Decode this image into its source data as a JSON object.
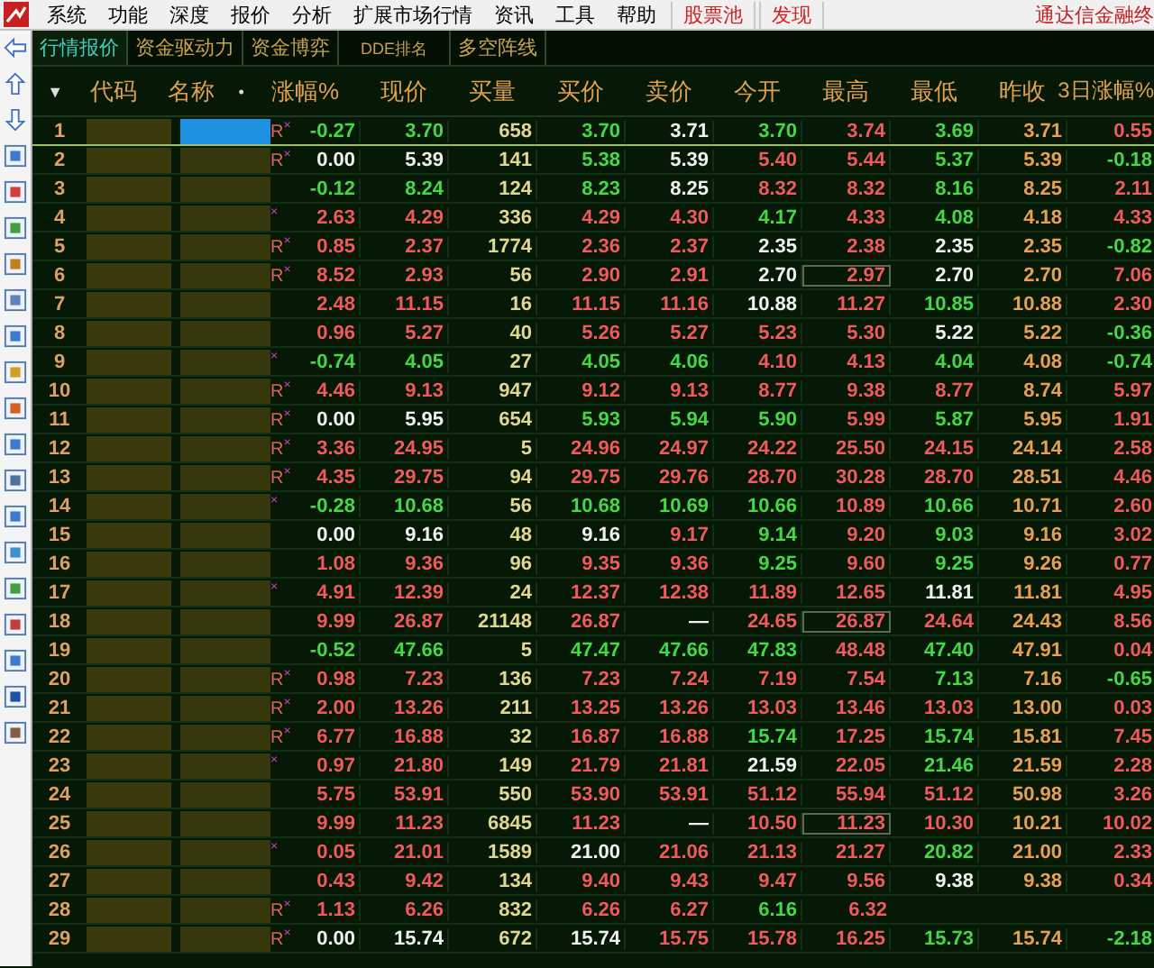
{
  "menu": {
    "items": [
      "系统",
      "功能",
      "深度",
      "报价",
      "分析",
      "扩展市场行情",
      "资讯",
      "工具",
      "帮助"
    ],
    "highlights": [
      "股票池",
      "发现"
    ],
    "brand": "通达信金融终"
  },
  "tabs": [
    {
      "label": "行情报价",
      "selected": true
    },
    {
      "label": "资金驱动力",
      "selected": false
    },
    {
      "label": "资金博弈",
      "selected": false
    },
    {
      "label": "DDE排名",
      "selected": false
    },
    {
      "label": "多空阵线",
      "selected": false
    }
  ],
  "header": {
    "menu_glyph": "▼",
    "code": "代码",
    "name": "名称",
    "mark": "•",
    "columns": [
      "涨幅%",
      "现价",
      "买量",
      "买价",
      "卖价",
      "今开",
      "最高",
      "最低",
      "昨收",
      "3日涨幅%"
    ]
  },
  "rows": [
    {
      "no": "1",
      "selected": true,
      "flag": "R$^{×}$",
      "cells": [
        {
          "text": "-0.27",
          "color": "#44d844"
        },
        {
          "text": "3.70",
          "color": "#44d844"
        },
        {
          "text": "658"
        },
        {
          "text": "3.70",
          "color": "#44d844"
        },
        {
          "text": "3.71",
          "color": "#f0f0f0"
        },
        {
          "text": "3.70",
          "color": "#44d844"
        },
        {
          "text": "3.74",
          "color": "#f05a5a"
        },
        {
          "text": "3.69",
          "color": "#44d844"
        },
        {
          "text": "3.71"
        },
        {
          "text": "0.55",
          "color": "#f05a5a"
        }
      ]
    },
    {
      "no": "2",
      "selected": false,
      "flag": "R$^{×}$",
      "cells": [
        {
          "text": "0.00",
          "color": "#f0f0f0"
        },
        {
          "text": "5.39",
          "color": "#f0f0f0"
        },
        {
          "text": "141"
        },
        {
          "text": "5.38",
          "color": "#44d844"
        },
        {
          "text": "5.39",
          "color": "#f0f0f0"
        },
        {
          "text": "5.40",
          "color": "#f05a5a"
        },
        {
          "text": "5.44",
          "color": "#f05a5a"
        },
        {
          "text": "5.37",
          "color": "#44d844"
        },
        {
          "text": "5.39"
        },
        {
          "text": "-0.18",
          "color": "#44d844"
        }
      ]
    },
    {
      "no": "3",
      "selected": false,
      "cells": [
        {
          "text": "-0.12",
          "color": "#44d844"
        },
        {
          "text": "8.24",
          "color": "#44d844"
        },
        {
          "text": "124"
        },
        {
          "text": "8.23",
          "color": "#44d844"
        },
        {
          "text": "8.25",
          "color": "#f0f0f0"
        },
        {
          "text": "8.32",
          "color": "#f05a5a"
        },
        {
          "text": "8.32",
          "color": "#f05a5a"
        },
        {
          "text": "8.16",
          "color": "#44d844"
        },
        {
          "text": "8.25"
        },
        {
          "text": "2.11",
          "color": "#f05a5a"
        }
      ]
    },
    {
      "no": "4",
      "selected": false,
      "flag": "$^{×}$",
      "cells": [
        {
          "text": "2.63",
          "color": "#f05a5a"
        },
        {
          "text": "4.29",
          "color": "#f05a5a"
        },
        {
          "text": "336"
        },
        {
          "text": "4.29",
          "color": "#f05a5a"
        },
        {
          "text": "4.30",
          "color": "#f05a5a"
        },
        {
          "text": "4.17",
          "color": "#44d844"
        },
        {
          "text": "4.33",
          "color": "#f05a5a"
        },
        {
          "text": "4.08",
          "color": "#44d844"
        },
        {
          "text": "4.18"
        },
        {
          "text": "4.33",
          "color": "#f05a5a"
        }
      ]
    },
    {
      "no": "5",
      "selected": false,
      "flag": "R$^{×}$",
      "cells": [
        {
          "text": "0.85",
          "color": "#f05a5a"
        },
        {
          "text": "2.37",
          "color": "#f05a5a"
        },
        {
          "text": "1774"
        },
        {
          "text": "2.36",
          "color": "#f05a5a"
        },
        {
          "text": "2.37",
          "color": "#f05a5a"
        },
        {
          "text": "2.35",
          "color": "#f0f0f0"
        },
        {
          "text": "2.38",
          "color": "#f05a5a"
        },
        {
          "text": "2.35",
          "color": "#f0f0f0"
        },
        {
          "text": "2.35"
        },
        {
          "text": "-0.82",
          "color": "#44d844"
        }
      ]
    },
    {
      "no": "6",
      "selected": false,
      "flag": "R$^{×}$",
      "cells": [
        {
          "text": "8.52",
          "color": "#f05a5a"
        },
        {
          "text": "2.93",
          "color": "#f05a5a"
        },
        {
          "text": "56"
        },
        {
          "text": "2.90",
          "color": "#f05a5a"
        },
        {
          "text": "2.91",
          "color": "#f05a5a"
        },
        {
          "text": "2.70",
          "color": "#f0f0f0"
        },
        {
          "text": "2.97",
          "color": "#f05a5a",
          "framed": true
        },
        {
          "text": "2.70",
          "color": "#f0f0f0"
        },
        {
          "text": "2.70"
        },
        {
          "text": "7.06",
          "color": "#f05a5a"
        }
      ]
    },
    {
      "no": "7",
      "selected": false,
      "cells": [
        {
          "text": "2.48",
          "color": "#f05a5a"
        },
        {
          "text": "11.15",
          "color": "#f05a5a"
        },
        {
          "text": "16"
        },
        {
          "text": "11.15",
          "color": "#f05a5a"
        },
        {
          "text": "11.16",
          "color": "#f05a5a"
        },
        {
          "text": "10.88",
          "color": "#f0f0f0"
        },
        {
          "text": "11.27",
          "color": "#f05a5a"
        },
        {
          "text": "10.85",
          "color": "#44d844"
        },
        {
          "text": "10.88"
        },
        {
          "text": "2.30",
          "color": "#f05a5a"
        }
      ]
    },
    {
      "no": "8",
      "selected": false,
      "cells": [
        {
          "text": "0.96",
          "color": "#f05a5a"
        },
        {
          "text": "5.27",
          "color": "#f05a5a"
        },
        {
          "text": "40"
        },
        {
          "text": "5.26",
          "color": "#f05a5a"
        },
        {
          "text": "5.27",
          "color": "#f05a5a"
        },
        {
          "text": "5.23",
          "color": "#f05a5a"
        },
        {
          "text": "5.30",
          "color": "#f05a5a"
        },
        {
          "text": "5.22",
          "color": "#f0f0f0"
        },
        {
          "text": "5.22"
        },
        {
          "text": "-0.36",
          "color": "#44d844"
        }
      ]
    },
    {
      "no": "9",
      "selected": false,
      "flag": "$^{×}$",
      "cells": [
        {
          "text": "-0.74",
          "color": "#44d844"
        },
        {
          "text": "4.05",
          "color": "#44d844"
        },
        {
          "text": "27"
        },
        {
          "text": "4.05",
          "color": "#44d844"
        },
        {
          "text": "4.06",
          "color": "#44d844"
        },
        {
          "text": "4.10",
          "color": "#f05a5a"
        },
        {
          "text": "4.13",
          "color": "#f05a5a"
        },
        {
          "text": "4.04",
          "color": "#44d844"
        },
        {
          "text": "4.08"
        },
        {
          "text": "-0.74",
          "color": "#44d844"
        }
      ]
    },
    {
      "no": "10",
      "selected": false,
      "flag": "R$^{×}$",
      "cells": [
        {
          "text": "4.46",
          "color": "#f05a5a"
        },
        {
          "text": "9.13",
          "color": "#f05a5a"
        },
        {
          "text": "947"
        },
        {
          "text": "9.12",
          "color": "#f05a5a"
        },
        {
          "text": "9.13",
          "color": "#f05a5a"
        },
        {
          "text": "8.77",
          "color": "#f05a5a"
        },
        {
          "text": "9.38",
          "color": "#f05a5a"
        },
        {
          "text": "8.77",
          "color": "#f05a5a"
        },
        {
          "text": "8.74"
        },
        {
          "text": "5.97",
          "color": "#f05a5a"
        }
      ]
    },
    {
      "no": "11",
      "selected": false,
      "flag": "R$^{×}$",
      "cells": [
        {
          "text": "0.00",
          "color": "#f0f0f0"
        },
        {
          "text": "5.95",
          "color": "#f0f0f0"
        },
        {
          "text": "654"
        },
        {
          "text": "5.93",
          "color": "#44d844"
        },
        {
          "text": "5.94",
          "color": "#44d844"
        },
        {
          "text": "5.90",
          "color": "#44d844"
        },
        {
          "text": "5.99",
          "color": "#f05a5a"
        },
        {
          "text": "5.87",
          "color": "#44d844"
        },
        {
          "text": "5.95"
        },
        {
          "text": "1.91",
          "color": "#f05a5a"
        }
      ]
    },
    {
      "no": "12",
      "selected": false,
      "flag": "R$^{×}$",
      "cells": [
        {
          "text": "3.36",
          "color": "#f05a5a"
        },
        {
          "text": "24.95",
          "color": "#f05a5a"
        },
        {
          "text": "5"
        },
        {
          "text": "24.96",
          "color": "#f05a5a"
        },
        {
          "text": "24.97",
          "color": "#f05a5a"
        },
        {
          "text": "24.22",
          "color": "#f05a5a"
        },
        {
          "text": "25.50",
          "color": "#f05a5a"
        },
        {
          "text": "24.15",
          "color": "#f05a5a"
        },
        {
          "text": "24.14"
        },
        {
          "text": "2.58",
          "color": "#f05a5a"
        }
      ]
    },
    {
      "no": "13",
      "selected": false,
      "flag": "R$^{×}$",
      "cells": [
        {
          "text": "4.35",
          "color": "#f05a5a"
        },
        {
          "text": "29.75",
          "color": "#f05a5a"
        },
        {
          "text": "94"
        },
        {
          "text": "29.75",
          "color": "#f05a5a"
        },
        {
          "text": "29.76",
          "color": "#f05a5a"
        },
        {
          "text": "28.70",
          "color": "#f05a5a"
        },
        {
          "text": "30.28",
          "color": "#f05a5a"
        },
        {
          "text": "28.70",
          "color": "#f05a5a"
        },
        {
          "text": "28.51"
        },
        {
          "text": "4.46",
          "color": "#f05a5a"
        }
      ]
    },
    {
      "no": "14",
      "selected": false,
      "flag": "$^{×}$",
      "cells": [
        {
          "text": "-0.28",
          "color": "#44d844"
        },
        {
          "text": "10.68",
          "color": "#44d844"
        },
        {
          "text": "56"
        },
        {
          "text": "10.68",
          "color": "#44d844"
        },
        {
          "text": "10.69",
          "color": "#44d844"
        },
        {
          "text": "10.66",
          "color": "#44d844"
        },
        {
          "text": "10.89",
          "color": "#f05a5a"
        },
        {
          "text": "10.66",
          "color": "#44d844"
        },
        {
          "text": "10.71"
        },
        {
          "text": "2.60",
          "color": "#f05a5a"
        }
      ]
    },
    {
      "no": "15",
      "selected": false,
      "cells": [
        {
          "text": "0.00",
          "color": "#f0f0f0"
        },
        {
          "text": "9.16",
          "color": "#f0f0f0"
        },
        {
          "text": "48"
        },
        {
          "text": "9.16",
          "color": "#f0f0f0"
        },
        {
          "text": "9.17",
          "color": "#f05a5a"
        },
        {
          "text": "9.14",
          "color": "#44d844"
        },
        {
          "text": "9.20",
          "color": "#f05a5a"
        },
        {
          "text": "9.03",
          "color": "#44d844"
        },
        {
          "text": "9.16"
        },
        {
          "text": "3.02",
          "color": "#f05a5a"
        }
      ]
    },
    {
      "no": "16",
      "selected": false,
      "cells": [
        {
          "text": "1.08",
          "color": "#f05a5a"
        },
        {
          "text": "9.36",
          "color": "#f05a5a"
        },
        {
          "text": "96"
        },
        {
          "text": "9.35",
          "color": "#f05a5a"
        },
        {
          "text": "9.36",
          "color": "#f05a5a"
        },
        {
          "text": "9.25",
          "color": "#44d844"
        },
        {
          "text": "9.60",
          "color": "#f05a5a"
        },
        {
          "text": "9.25",
          "color": "#44d844"
        },
        {
          "text": "9.26"
        },
        {
          "text": "0.77",
          "color": "#f05a5a"
        }
      ]
    },
    {
      "no": "17",
      "selected": false,
      "flag": "$^{×}$",
      "cells": [
        {
          "text": "4.91",
          "color": "#f05a5a"
        },
        {
          "text": "12.39",
          "color": "#f05a5a"
        },
        {
          "text": "24"
        },
        {
          "text": "12.37",
          "color": "#f05a5a"
        },
        {
          "text": "12.38",
          "color": "#f05a5a"
        },
        {
          "text": "11.89",
          "color": "#f05a5a"
        },
        {
          "text": "12.65",
          "color": "#f05a5a"
        },
        {
          "text": "11.81",
          "color": "#f0f0f0"
        },
        {
          "text": "11.81"
        },
        {
          "text": "4.95",
          "color": "#f05a5a"
        }
      ]
    },
    {
      "no": "18",
      "selected": false,
      "cells": [
        {
          "text": "9.99",
          "color": "#f05a5a"
        },
        {
          "text": "26.87",
          "color": "#f05a5a"
        },
        {
          "text": "21148"
        },
        {
          "text": "26.87",
          "color": "#f05a5a"
        },
        {
          "text": "—",
          "color": "#f0f0f0"
        },
        {
          "text": "24.65",
          "color": "#f05a5a"
        },
        {
          "text": "26.87",
          "color": "#f05a5a",
          "framed": true
        },
        {
          "text": "24.64",
          "color": "#f05a5a"
        },
        {
          "text": "24.43"
        },
        {
          "text": "8.56",
          "color": "#f05a5a"
        }
      ]
    },
    {
      "no": "19",
      "selected": false,
      "cells": [
        {
          "text": "-0.52",
          "color": "#44d844"
        },
        {
          "text": "47.66",
          "color": "#44d844"
        },
        {
          "text": "5"
        },
        {
          "text": "47.47",
          "color": "#44d844"
        },
        {
          "text": "47.66",
          "color": "#44d844"
        },
        {
          "text": "47.83",
          "color": "#44d844"
        },
        {
          "text": "48.48",
          "color": "#f05a5a"
        },
        {
          "text": "47.40",
          "color": "#44d844"
        },
        {
          "text": "47.91"
        },
        {
          "text": "0.04",
          "color": "#f05a5a"
        }
      ]
    },
    {
      "no": "20",
      "selected": false,
      "flag": "R$^{×}$",
      "cells": [
        {
          "text": "0.98",
          "color": "#f05a5a"
        },
        {
          "text": "7.23",
          "color": "#f05a5a"
        },
        {
          "text": "136"
        },
        {
          "text": "7.23",
          "color": "#f05a5a"
        },
        {
          "text": "7.24",
          "color": "#f05a5a"
        },
        {
          "text": "7.19",
          "color": "#f05a5a"
        },
        {
          "text": "7.54",
          "color": "#f05a5a"
        },
        {
          "text": "7.13",
          "color": "#44d844"
        },
        {
          "text": "7.16"
        },
        {
          "text": "-0.65",
          "color": "#44d844"
        }
      ]
    },
    {
      "no": "21",
      "selected": false,
      "flag": "R$^{×}$",
      "cells": [
        {
          "text": "2.00",
          "color": "#f05a5a"
        },
        {
          "text": "13.26",
          "color": "#f05a5a"
        },
        {
          "text": "211"
        },
        {
          "text": "13.25",
          "color": "#f05a5a"
        },
        {
          "text": "13.26",
          "color": "#f05a5a"
        },
        {
          "text": "13.03",
          "color": "#f05a5a"
        },
        {
          "text": "13.46",
          "color": "#f05a5a"
        },
        {
          "text": "13.03",
          "color": "#f05a5a"
        },
        {
          "text": "13.00"
        },
        {
          "text": "0.03",
          "color": "#f05a5a"
        }
      ]
    },
    {
      "no": "22",
      "selected": false,
      "flag": "R$^{×}$",
      "cells": [
        {
          "text": "6.77",
          "color": "#f05a5a"
        },
        {
          "text": "16.88",
          "color": "#f05a5a"
        },
        {
          "text": "32"
        },
        {
          "text": "16.87",
          "color": "#f05a5a"
        },
        {
          "text": "16.88",
          "color": "#f05a5a"
        },
        {
          "text": "15.74",
          "color": "#44d844"
        },
        {
          "text": "17.25",
          "color": "#f05a5a"
        },
        {
          "text": "15.74",
          "color": "#44d844"
        },
        {
          "text": "15.81"
        },
        {
          "text": "7.45",
          "color": "#f05a5a"
        }
      ]
    },
    {
      "no": "23",
      "selected": false,
      "flag": "$^{×}$",
      "cells": [
        {
          "text": "0.97",
          "color": "#f05a5a"
        },
        {
          "text": "21.80",
          "color": "#f05a5a"
        },
        {
          "text": "149"
        },
        {
          "text": "21.79",
          "color": "#f05a5a"
        },
        {
          "text": "21.81",
          "color": "#f05a5a"
        },
        {
          "text": "21.59",
          "color": "#f0f0f0"
        },
        {
          "text": "22.05",
          "color": "#f05a5a"
        },
        {
          "text": "21.46",
          "color": "#44d844"
        },
        {
          "text": "21.59"
        },
        {
          "text": "2.28",
          "color": "#f05a5a"
        }
      ]
    },
    {
      "no": "24",
      "selected": false,
      "cells": [
        {
          "text": "5.75",
          "color": "#f05a5a"
        },
        {
          "text": "53.91",
          "color": "#f05a5a"
        },
        {
          "text": "550"
        },
        {
          "text": "53.90",
          "color": "#f05a5a"
        },
        {
          "text": "53.91",
          "color": "#f05a5a"
        },
        {
          "text": "51.12",
          "color": "#f05a5a"
        },
        {
          "text": "55.94",
          "color": "#f05a5a"
        },
        {
          "text": "51.12",
          "color": "#f05a5a"
        },
        {
          "text": "50.98"
        },
        {
          "text": "3.26",
          "color": "#f05a5a"
        }
      ]
    },
    {
      "no": "25",
      "selected": false,
      "cells": [
        {
          "text": "9.99",
          "color": "#f05a5a"
        },
        {
          "text": "11.23",
          "color": "#f05a5a"
        },
        {
          "text": "6845"
        },
        {
          "text": "11.23",
          "color": "#f05a5a"
        },
        {
          "text": "—",
          "color": "#f0f0f0"
        },
        {
          "text": "10.50",
          "color": "#f05a5a"
        },
        {
          "text": "11.23",
          "color": "#f05a5a",
          "framed": true
        },
        {
          "text": "10.30",
          "color": "#f05a5a"
        },
        {
          "text": "10.21"
        },
        {
          "text": "10.02",
          "color": "#f05a5a"
        }
      ]
    },
    {
      "no": "26",
      "selected": false,
      "flag": "$^{×}$",
      "cells": [
        {
          "text": "0.05",
          "color": "#f05a5a"
        },
        {
          "text": "21.01",
          "color": "#f05a5a"
        },
        {
          "text": "1589"
        },
        {
          "text": "21.00",
          "color": "#f0f0f0"
        },
        {
          "text": "21.06",
          "color": "#f05a5a"
        },
        {
          "text": "21.13",
          "color": "#f05a5a"
        },
        {
          "text": "21.27",
          "color": "#f05a5a"
        },
        {
          "text": "20.82",
          "color": "#44d844"
        },
        {
          "text": "21.00"
        },
        {
          "text": "2.33",
          "color": "#f05a5a"
        }
      ]
    },
    {
      "no": "27",
      "selected": false,
      "cells": [
        {
          "text": "0.43",
          "color": "#f05a5a"
        },
        {
          "text": "9.42",
          "color": "#f05a5a"
        },
        {
          "text": "134"
        },
        {
          "text": "9.40",
          "color": "#f05a5a"
        },
        {
          "text": "9.43",
          "color": "#f05a5a"
        },
        {
          "text": "9.47",
          "color": "#f05a5a"
        },
        {
          "text": "9.56",
          "color": "#f05a5a"
        },
        {
          "text": "9.38",
          "color": "#f0f0f0"
        },
        {
          "text": "9.38"
        },
        {
          "text": "0.34",
          "color": "#f05a5a"
        }
      ]
    },
    {
      "no": "28",
      "selected": false,
      "flag": "R$^{×}$",
      "cells": [
        {
          "text": "1.13",
          "color": "#f05a5a"
        },
        {
          "text": "6.26",
          "color": "#f05a5a"
        },
        {
          "text": "832"
        },
        {
          "text": "6.26",
          "color": "#f05a5a"
        },
        {
          "text": "6.27",
          "color": "#f05a5a"
        },
        {
          "text": "6.16",
          "color": "#44d844"
        },
        {
          "text": "6.32",
          "color": "#f05a5a"
        }
      ]
    },
    {
      "no": "29",
      "selected": false,
      "flag": "R$^{×}$",
      "cells": [
        {
          "text": "0.00",
          "color": "#f0f0f0"
        },
        {
          "text": "15.74",
          "color": "#f0f0f0"
        },
        {
          "text": "672"
        },
        {
          "text": "15.74",
          "color": "#f0f0f0"
        },
        {
          "text": "15.75",
          "color": "#f05a5a"
        },
        {
          "text": "15.78",
          "color": "#f05a5a"
        },
        {
          "text": "16.25",
          "color": "#f05a5a"
        },
        {
          "text": "15.73",
          "color": "#44d844"
        },
        {
          "text": "15.74"
        },
        {
          "text": "-2.18",
          "color": "#44d844"
        }
      ]
    }
  ]
}
